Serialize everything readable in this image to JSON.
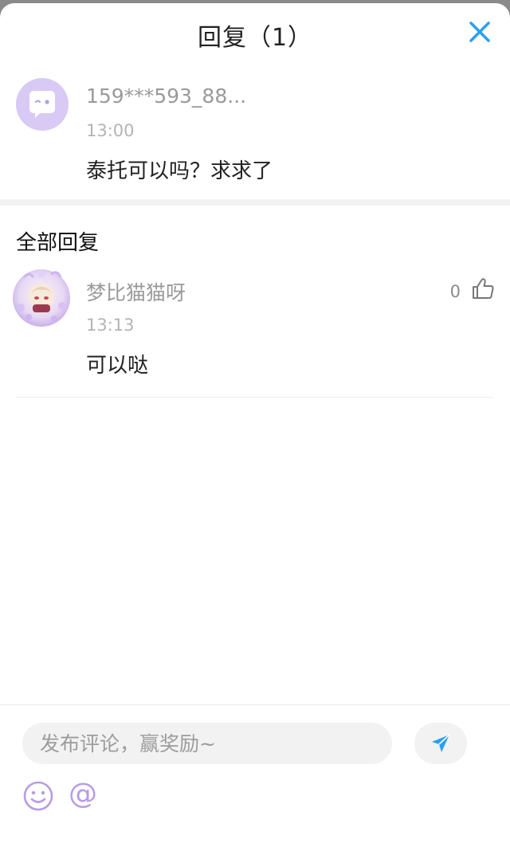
{
  "header": {
    "title": "回复（1）"
  },
  "original_comment": {
    "username": "159***593_88...",
    "time": "13:00",
    "text": "泰托可以吗？求求了"
  },
  "replies_section": {
    "label": "全部回复"
  },
  "replies": [
    {
      "username": "梦比猫猫呀",
      "time": "13:13",
      "text": "可以哒",
      "likes": "0"
    }
  ],
  "composer": {
    "placeholder": "发布评论，赢奖励~",
    "at_symbol": "@"
  },
  "colors": {
    "accent": "#2a9ff0",
    "avatar_bg": "#d9c9f5",
    "icon_purple": "#b89de0"
  },
  "icons": {
    "close": "close-icon",
    "like": "thumbs-up-icon",
    "send": "send-icon",
    "emoji": "smiley-icon"
  }
}
